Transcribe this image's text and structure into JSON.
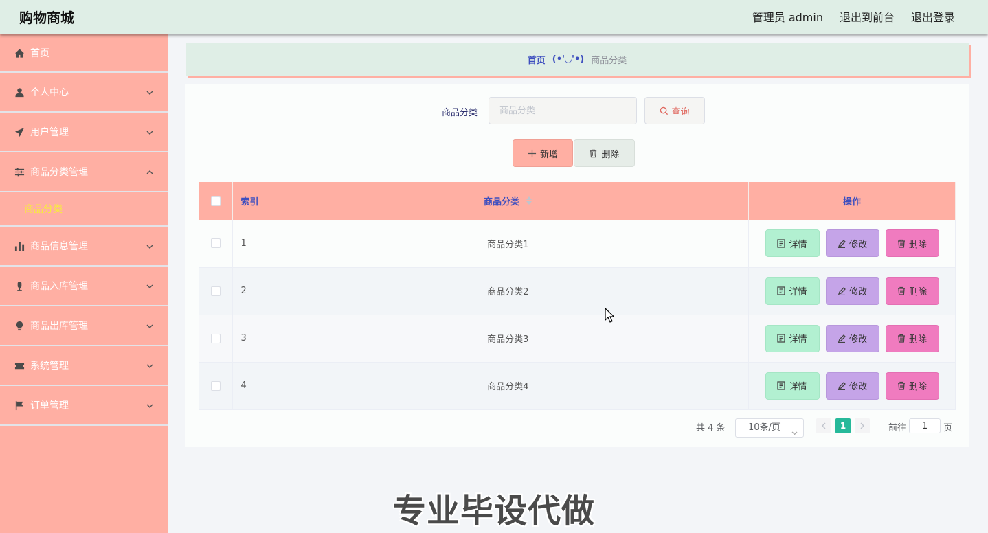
{
  "header": {
    "brand": "购物商城",
    "nav": [
      "管理员 admin",
      "退出到前台",
      "退出登录"
    ]
  },
  "sidebar": {
    "items": [
      {
        "label": "首页",
        "icon": "home-icon",
        "expandable": false
      },
      {
        "label": "个人中心",
        "icon": "user-icon",
        "expandable": true,
        "open": false
      },
      {
        "label": "用户管理",
        "icon": "send-icon",
        "expandable": true,
        "open": false
      },
      {
        "label": "商品分类管理",
        "icon": "sliders-icon",
        "expandable": true,
        "open": true,
        "children": [
          "商品分类"
        ]
      },
      {
        "label": "商品信息管理",
        "icon": "bar-chart-icon",
        "expandable": true,
        "open": false
      },
      {
        "label": "商品入库管理",
        "icon": "microphone-icon",
        "expandable": true,
        "open": false
      },
      {
        "label": "商品出库管理",
        "icon": "lightbulb-icon",
        "expandable": true,
        "open": false
      },
      {
        "label": "系统管理",
        "icon": "ticket-icon",
        "expandable": true,
        "open": false
      },
      {
        "label": "订单管理",
        "icon": "flag-icon",
        "expandable": true,
        "open": false
      }
    ]
  },
  "breadcrumb": {
    "home": "首页",
    "separator": "(•'◡'•)",
    "current": "商品分类"
  },
  "search": {
    "label": "商品分类",
    "placeholder": "商品分类",
    "query_button": "查询"
  },
  "actions": {
    "add_button": "新增",
    "delete_button": "删除"
  },
  "table": {
    "columns": [
      "索引",
      "商品分类",
      "操作"
    ],
    "rows": [
      {
        "index": "1",
        "name": "商品分类1"
      },
      {
        "index": "2",
        "name": "商品分类2"
      },
      {
        "index": "3",
        "name": "商品分类3"
      },
      {
        "index": "4",
        "name": "商品分类4"
      }
    ],
    "row_actions": {
      "detail": "详情",
      "edit": "修改",
      "delete": "删除"
    }
  },
  "pagination": {
    "total": "共 4 条",
    "page_size": "10条/页",
    "current_page": "1",
    "goto_label": "前往",
    "goto_value": "1",
    "page_suffix": "页"
  },
  "watermark": "专业毕设代做",
  "colors": {
    "header_bg": "#dfeee6",
    "sidebar_bg": "#ffafa3",
    "active_submenu": "#f7ee3a",
    "accent_blue": "#3e4fbf",
    "pager_active": "#26b99a"
  }
}
